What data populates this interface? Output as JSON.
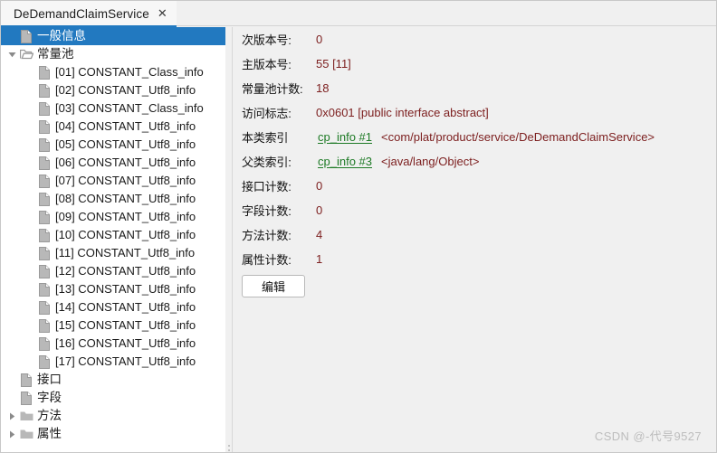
{
  "window": {
    "accent_color": "#2279c0",
    "tree_bg": "#ffffff",
    "panel_bg": "#f0f0f0",
    "value_color": "#7d2020",
    "link_color": "#1d7a25"
  },
  "tabbar": {
    "tabs": [
      {
        "label": "DeDemandClaimService",
        "close": "✕",
        "active": true
      }
    ]
  },
  "tree": {
    "nodes": [
      {
        "label": "一般信息",
        "icon": "file-icon",
        "indent": 0,
        "twisty": "none",
        "selected": true,
        "cjk": true
      },
      {
        "label": "常量池",
        "icon": "folder-open-icon",
        "indent": 0,
        "twisty": "expanded",
        "selected": false,
        "cjk": true
      },
      {
        "label": "[01] CONSTANT_Class_info",
        "icon": "file-icon",
        "indent": 1,
        "twisty": "none",
        "selected": false,
        "cjk": false
      },
      {
        "label": "[02] CONSTANT_Utf8_info",
        "icon": "file-icon",
        "indent": 1,
        "twisty": "none",
        "selected": false,
        "cjk": false
      },
      {
        "label": "[03] CONSTANT_Class_info",
        "icon": "file-icon",
        "indent": 1,
        "twisty": "none",
        "selected": false,
        "cjk": false
      },
      {
        "label": "[04] CONSTANT_Utf8_info",
        "icon": "file-icon",
        "indent": 1,
        "twisty": "none",
        "selected": false,
        "cjk": false
      },
      {
        "label": "[05] CONSTANT_Utf8_info",
        "icon": "file-icon",
        "indent": 1,
        "twisty": "none",
        "selected": false,
        "cjk": false
      },
      {
        "label": "[06] CONSTANT_Utf8_info",
        "icon": "file-icon",
        "indent": 1,
        "twisty": "none",
        "selected": false,
        "cjk": false
      },
      {
        "label": "[07] CONSTANT_Utf8_info",
        "icon": "file-icon",
        "indent": 1,
        "twisty": "none",
        "selected": false,
        "cjk": false
      },
      {
        "label": "[08] CONSTANT_Utf8_info",
        "icon": "file-icon",
        "indent": 1,
        "twisty": "none",
        "selected": false,
        "cjk": false
      },
      {
        "label": "[09] CONSTANT_Utf8_info",
        "icon": "file-icon",
        "indent": 1,
        "twisty": "none",
        "selected": false,
        "cjk": false
      },
      {
        "label": "[10] CONSTANT_Utf8_info",
        "icon": "file-icon",
        "indent": 1,
        "twisty": "none",
        "selected": false,
        "cjk": false
      },
      {
        "label": "[11] CONSTANT_Utf8_info",
        "icon": "file-icon",
        "indent": 1,
        "twisty": "none",
        "selected": false,
        "cjk": false
      },
      {
        "label": "[12] CONSTANT_Utf8_info",
        "icon": "file-icon",
        "indent": 1,
        "twisty": "none",
        "selected": false,
        "cjk": false
      },
      {
        "label": "[13] CONSTANT_Utf8_info",
        "icon": "file-icon",
        "indent": 1,
        "twisty": "none",
        "selected": false,
        "cjk": false
      },
      {
        "label": "[14] CONSTANT_Utf8_info",
        "icon": "file-icon",
        "indent": 1,
        "twisty": "none",
        "selected": false,
        "cjk": false
      },
      {
        "label": "[15] CONSTANT_Utf8_info",
        "icon": "file-icon",
        "indent": 1,
        "twisty": "none",
        "selected": false,
        "cjk": false
      },
      {
        "label": "[16] CONSTANT_Utf8_info",
        "icon": "file-icon",
        "indent": 1,
        "twisty": "none",
        "selected": false,
        "cjk": false
      },
      {
        "label": "[17] CONSTANT_Utf8_info",
        "icon": "file-icon",
        "indent": 1,
        "twisty": "none",
        "selected": false,
        "cjk": false
      },
      {
        "label": "接口",
        "icon": "file-icon",
        "indent": 0,
        "twisty": "none",
        "selected": false,
        "cjk": true
      },
      {
        "label": "字段",
        "icon": "file-icon",
        "indent": 0,
        "twisty": "none",
        "selected": false,
        "cjk": true
      },
      {
        "label": "方法",
        "icon": "folder-closed-icon",
        "indent": 0,
        "twisty": "collapsed",
        "selected": false,
        "cjk": true
      },
      {
        "label": "属性",
        "icon": "folder-closed-icon",
        "indent": 0,
        "twisty": "collapsed",
        "selected": false,
        "cjk": true
      }
    ]
  },
  "detail": {
    "rows": [
      {
        "label": "次版本号:",
        "value": "0",
        "link": "",
        "extra": ""
      },
      {
        "label": "主版本号:",
        "value": "55 [11]",
        "link": "",
        "extra": ""
      },
      {
        "label": "常量池计数:",
        "value": "18",
        "link": "",
        "extra": ""
      },
      {
        "label": "访问标志:",
        "value": "0x0601 [public interface abstract]",
        "link": "",
        "extra": ""
      },
      {
        "label": "本类索引",
        "value": "",
        "link": "cp_info #1",
        "extra": "<com/plat/product/service/DeDemandClaimService>"
      },
      {
        "label": "父类索引:",
        "value": "",
        "link": "cp_info #3",
        "extra": "<java/lang/Object>"
      },
      {
        "label": "接口计数:",
        "value": "0",
        "link": "",
        "extra": ""
      },
      {
        "label": "字段计数:",
        "value": "0",
        "link": "",
        "extra": ""
      },
      {
        "label": "方法计数:",
        "value": "4",
        "link": "",
        "extra": ""
      },
      {
        "label": "属性计数:",
        "value": "1",
        "link": "",
        "extra": ""
      }
    ],
    "edit_button": "编辑"
  },
  "watermark": {
    "text": "CSDN @-代号9527"
  }
}
